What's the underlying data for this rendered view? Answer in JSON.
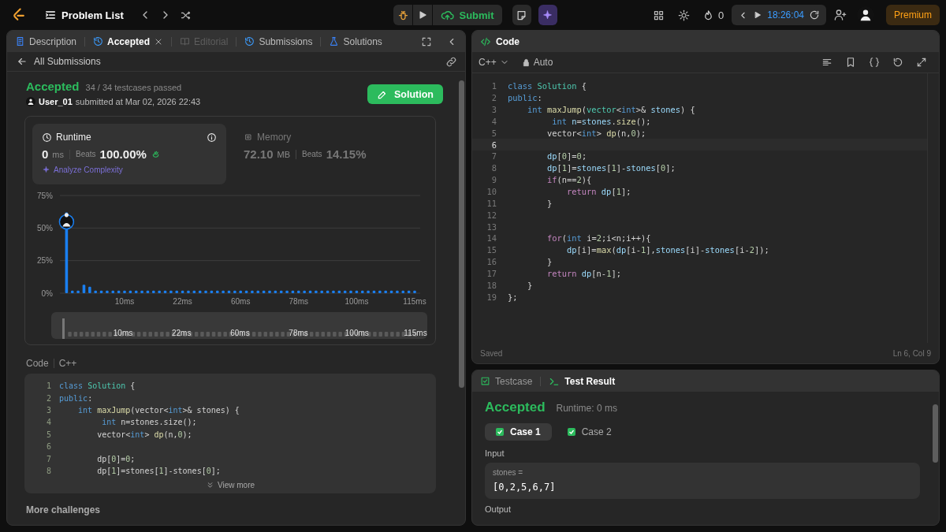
{
  "topbar": {
    "problem_list": "Problem List",
    "submit": "Submit",
    "streak": "0",
    "timer": "18:26:04",
    "premium": "Premium"
  },
  "left_panel": {
    "tabs": [
      {
        "label": "Description",
        "selected": false,
        "disabled": false
      },
      {
        "label": "Accepted",
        "selected": true,
        "disabled": false
      },
      {
        "label": "Editorial",
        "selected": false,
        "disabled": true
      },
      {
        "label": "Submissions",
        "selected": false,
        "disabled": false
      },
      {
        "label": "Solutions",
        "selected": false,
        "disabled": false
      }
    ],
    "back_link": "All Submissions",
    "submission": {
      "status": "Accepted",
      "testcases": "34 / 34 testcases passed",
      "user": "User_01",
      "submitted": "submitted at Mar 02, 2026 22:43",
      "solution_button": "Solution"
    },
    "stats": [
      {
        "label": "Runtime",
        "value": "0",
        "unit": "ms",
        "beats_label": "Beats",
        "beats": "100.00%",
        "selected": true
      },
      {
        "label": "Memory",
        "value": "72.10",
        "unit": "MB",
        "beats_label": "Beats",
        "beats": "14.15%",
        "selected": false
      }
    ],
    "analyze": "Analyze Complexity",
    "chart_data": {
      "type": "bar",
      "categories": [
        null,
        null,
        null,
        null,
        null,
        null,
        null,
        null,
        null,
        null,
        "10ms",
        null,
        null,
        null,
        null,
        null,
        null,
        null,
        null,
        null,
        "22ms",
        null,
        null,
        null,
        null,
        null,
        null,
        null,
        null,
        null,
        "60ms",
        null,
        null,
        null,
        null,
        null,
        null,
        null,
        null,
        null,
        "78ms",
        null,
        null,
        null,
        null,
        null,
        null,
        null,
        null,
        null,
        "100ms",
        null,
        null,
        null,
        null,
        null,
        null,
        null,
        null,
        null,
        "115ms"
      ],
      "series": [
        {
          "color": "#1a7ff0",
          "values": [
            62,
            2,
            2,
            6.5,
            5,
            2,
            2,
            2,
            2,
            2,
            2,
            2,
            2,
            2,
            2,
            2,
            2,
            2,
            2,
            2,
            2,
            2,
            2,
            2,
            2,
            2,
            2,
            2,
            2,
            2,
            2,
            2,
            2,
            2,
            2,
            2,
            2,
            2,
            2,
            2,
            2,
            2,
            2,
            2,
            2,
            2,
            2,
            2,
            2,
            2,
            2,
            2,
            2,
            2,
            2,
            2,
            2,
            2,
            2,
            2,
            2
          ]
        }
      ],
      "ylim": [
        0,
        75
      ],
      "yticks": [
        {
          "value": 0,
          "label": "0%"
        },
        {
          "value": 25,
          "label": "25%"
        },
        {
          "value": 50,
          "label": "50%"
        },
        {
          "value": 75,
          "label": "75%"
        }
      ]
    },
    "overview_labels": [
      "10ms",
      "22ms",
      "60ms",
      "78ms",
      "100ms",
      "115ms"
    ],
    "code": {
      "label": "Code",
      "language": "C++",
      "view_more": "View more",
      "lines": [
        {
          "n": "1",
          "tokens": [
            {
              "text": "class ",
              "kind": "k"
            },
            {
              "text": "Solution",
              "kind": "t"
            },
            {
              "text": " {",
              "kind": "p"
            }
          ]
        },
        {
          "n": "2",
          "tokens": [
            {
              "text": "public",
              "kind": "k"
            },
            {
              "text": ":",
              "kind": "p"
            }
          ]
        },
        {
          "n": "3",
          "tokens": [
            {
              "text": "    int ",
              "kind": "k"
            },
            {
              "text": "maxJump",
              "kind": "f"
            },
            {
              "text": "(vector<",
              "kind": "p"
            },
            {
              "text": "int",
              "kind": "k"
            },
            {
              "text": ">& stones) {",
              "kind": "p"
            }
          ]
        },
        {
          "n": "4",
          "tokens": [
            {
              "text": "         int ",
              "kind": "k"
            },
            {
              "text": "n=stones.size();",
              "kind": "p"
            }
          ]
        },
        {
          "n": "5",
          "tokens": [
            {
              "text": "        vector<",
              "kind": "p"
            },
            {
              "text": "int",
              "kind": "k"
            },
            {
              "text": "> ",
              "kind": "p"
            },
            {
              "text": "dp",
              "kind": "f"
            },
            {
              "text": "(n,",
              "kind": "p"
            },
            {
              "text": "0",
              "kind": "n"
            },
            {
              "text": ");",
              "kind": "p"
            }
          ]
        },
        {
          "n": "6"
        },
        {
          "n": "7",
          "tokens": [
            {
              "text": "        dp[",
              "kind": "p"
            },
            {
              "text": "0",
              "kind": "n"
            },
            {
              "text": "]=",
              "kind": "p"
            },
            {
              "text": "0",
              "kind": "n"
            },
            {
              "text": ";",
              "kind": "p"
            }
          ]
        },
        {
          "n": "8",
          "tokens": [
            {
              "text": "        dp[",
              "kind": "p"
            },
            {
              "text": "1",
              "kind": "n"
            },
            {
              "text": "]=stones[",
              "kind": "p"
            },
            {
              "text": "1",
              "kind": "n"
            },
            {
              "text": "]-stones[",
              "kind": "p"
            },
            {
              "text": "0",
              "kind": "n"
            },
            {
              "text": "];",
              "kind": "p"
            }
          ]
        }
      ]
    },
    "more_challenges": "More challenges"
  },
  "editor": {
    "title": "Code",
    "language": "C++",
    "mode": "Auto",
    "status": "Saved",
    "cursor": "Ln 6, Col 9",
    "lines": [
      {
        "n": "1",
        "current": false,
        "tokens": [
          {
            "text": "class ",
            "kind": "k"
          },
          {
            "text": "Solution",
            "kind": "t"
          },
          {
            "text": " {",
            "kind": "p"
          }
        ]
      },
      {
        "n": "2",
        "current": false,
        "tokens": [
          {
            "text": "public",
            "kind": "k"
          },
          {
            "text": ":",
            "kind": "p"
          }
        ]
      },
      {
        "n": "3",
        "current": false,
        "tokens": [
          {
            "text": "    int ",
            "kind": "k"
          },
          {
            "text": "maxJump",
            "kind": "f"
          },
          {
            "text": "(",
            "kind": "p"
          },
          {
            "text": "vector",
            "kind": "t"
          },
          {
            "text": "<",
            "kind": "p"
          },
          {
            "text": "int",
            "kind": "k"
          },
          {
            "text": ">& ",
            "kind": "p"
          },
          {
            "text": "stones",
            "kind": "v"
          },
          {
            "text": ") {",
            "kind": "p"
          }
        ]
      },
      {
        "n": "4",
        "current": false,
        "tokens": [
          {
            "text": "         int ",
            "kind": "k"
          },
          {
            "text": "n",
            "kind": "v"
          },
          {
            "text": "=",
            "kind": "p"
          },
          {
            "text": "stones",
            "kind": "v"
          },
          {
            "text": ".",
            "kind": "p"
          },
          {
            "text": "size",
            "kind": "f"
          },
          {
            "text": "();",
            "kind": "p"
          }
        ]
      },
      {
        "n": "5",
        "current": false,
        "tokens": [
          {
            "text": "        vector<",
            "kind": "p"
          },
          {
            "text": "int",
            "kind": "k"
          },
          {
            "text": "> ",
            "kind": "p"
          },
          {
            "text": "dp",
            "kind": "f"
          },
          {
            "text": "(n,",
            "kind": "p"
          },
          {
            "text": "0",
            "kind": "n"
          },
          {
            "text": ");",
            "kind": "p"
          }
        ]
      },
      {
        "n": "6",
        "current": true
      },
      {
        "n": "7",
        "current": false,
        "tokens": [
          {
            "text": "        dp",
            "kind": "v"
          },
          {
            "text": "[",
            "kind": "p"
          },
          {
            "text": "0",
            "kind": "n"
          },
          {
            "text": "]=",
            "kind": "p"
          },
          {
            "text": "0",
            "kind": "n"
          },
          {
            "text": ";",
            "kind": "p"
          }
        ]
      },
      {
        "n": "8",
        "current": false,
        "tokens": [
          {
            "text": "        dp",
            "kind": "v"
          },
          {
            "text": "[",
            "kind": "p"
          },
          {
            "text": "1",
            "kind": "n"
          },
          {
            "text": "]=",
            "kind": "p"
          },
          {
            "text": "stones",
            "kind": "v"
          },
          {
            "text": "[",
            "kind": "p"
          },
          {
            "text": "1",
            "kind": "n"
          },
          {
            "text": "]-",
            "kind": "p"
          },
          {
            "text": "stones",
            "kind": "v"
          },
          {
            "text": "[",
            "kind": "p"
          },
          {
            "text": "0",
            "kind": "n"
          },
          {
            "text": "];",
            "kind": "p"
          }
        ]
      },
      {
        "n": "9",
        "current": false,
        "tokens": [
          {
            "text": "        if",
            "kind": "c"
          },
          {
            "text": "(n==",
            "kind": "p"
          },
          {
            "text": "2",
            "kind": "n"
          },
          {
            "text": "){",
            "kind": "p"
          }
        ]
      },
      {
        "n": "10",
        "current": false,
        "tokens": [
          {
            "text": "            return ",
            "kind": "c"
          },
          {
            "text": "dp",
            "kind": "v"
          },
          {
            "text": "[",
            "kind": "p"
          },
          {
            "text": "1",
            "kind": "n"
          },
          {
            "text": "];",
            "kind": "p"
          }
        ]
      },
      {
        "n": "11",
        "current": false,
        "tokens": [
          {
            "text": "        }",
            "kind": "p"
          }
        ]
      },
      {
        "n": "12",
        "current": false
      },
      {
        "n": "13",
        "current": false
      },
      {
        "n": "14",
        "current": false,
        "tokens": [
          {
            "text": "        for",
            "kind": "c"
          },
          {
            "text": "(",
            "kind": "p"
          },
          {
            "text": "int",
            "kind": "k"
          },
          {
            "text": " i=",
            "kind": "p"
          },
          {
            "text": "2",
            "kind": "n"
          },
          {
            "text": ";i<n;i++){",
            "kind": "p"
          }
        ]
      },
      {
        "n": "15",
        "current": false,
        "tokens": [
          {
            "text": "            dp",
            "kind": "v"
          },
          {
            "text": "[i]=",
            "kind": "p"
          },
          {
            "text": "max",
            "kind": "f"
          },
          {
            "text": "(",
            "kind": "p"
          },
          {
            "text": "dp",
            "kind": "v"
          },
          {
            "text": "[i-",
            "kind": "p"
          },
          {
            "text": "1",
            "kind": "n"
          },
          {
            "text": "],",
            "kind": "p"
          },
          {
            "text": "stones",
            "kind": "v"
          },
          {
            "text": "[i]-",
            "kind": "p"
          },
          {
            "text": "stones",
            "kind": "v"
          },
          {
            "text": "[i-",
            "kind": "p"
          },
          {
            "text": "2",
            "kind": "n"
          },
          {
            "text": "]);",
            "kind": "p"
          }
        ]
      },
      {
        "n": "16",
        "current": false,
        "tokens": [
          {
            "text": "        }",
            "kind": "p"
          }
        ]
      },
      {
        "n": "17",
        "current": false,
        "tokens": [
          {
            "text": "        return ",
            "kind": "c"
          },
          {
            "text": "dp",
            "kind": "v"
          },
          {
            "text": "[n-",
            "kind": "p"
          },
          {
            "text": "1",
            "kind": "n"
          },
          {
            "text": "];",
            "kind": "p"
          }
        ]
      },
      {
        "n": "18",
        "current": false,
        "tokens": [
          {
            "text": "    }",
            "kind": "p"
          }
        ]
      },
      {
        "n": "19",
        "current": false,
        "tokens": [
          {
            "text": "};",
            "kind": "p"
          }
        ]
      }
    ]
  },
  "results": {
    "tabs": [
      {
        "label": "Testcase",
        "selected": false
      },
      {
        "label": "Test Result",
        "selected": true
      }
    ],
    "status": "Accepted",
    "runtime": "Runtime: 0 ms",
    "cases": [
      {
        "label": "Case 1",
        "selected": true,
        "passed": true
      },
      {
        "label": "Case 2",
        "selected": false,
        "passed": true
      }
    ],
    "input_label": "Input",
    "inputs": [
      {
        "name": "stones =",
        "value": "[0,2,5,6,7]"
      }
    ],
    "output_label": "Output"
  }
}
